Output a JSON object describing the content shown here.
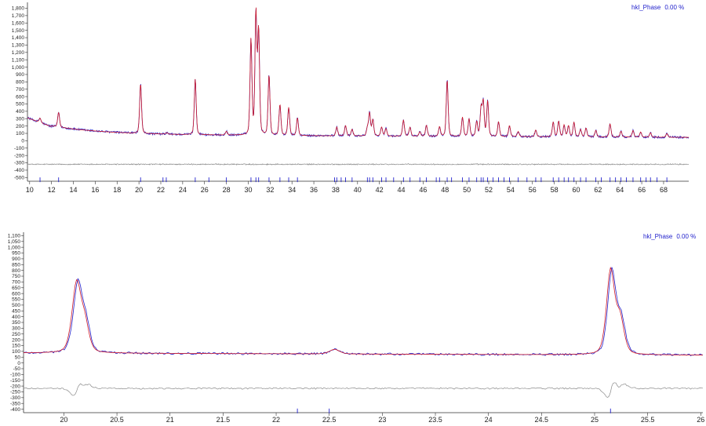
{
  "colors": {
    "observed": "#1f1fcc",
    "calculated": "#d01c2a",
    "difference": "#8a8a8a",
    "hkl": "#2222cc",
    "axis": "#333333"
  },
  "chart_data": [
    {
      "type": "line",
      "legend": {
        "label": "hkl_Phase",
        "value": "0.00 %",
        "placement": "top-right"
      },
      "xlim": [
        9.8,
        70.3
      ],
      "ylim": [
        -550,
        1880
      ],
      "y_ticks": [
        -500,
        -400,
        -300,
        -200,
        -100,
        0,
        100,
        200,
        300,
        400,
        500,
        600,
        700,
        800,
        900,
        1000,
        1100,
        1200,
        1300,
        1400,
        1500,
        1600,
        1700,
        1800
      ],
      "y_tick_labels": [
        "-500",
        "-400",
        "-300",
        "-200",
        "-100",
        "0",
        "100",
        "200",
        "300",
        "400",
        "500",
        "600",
        "700",
        "800",
        "900",
        "1,000",
        "1,100",
        "1,200",
        "1,300",
        "1,400",
        "1,500",
        "1,600",
        "1,700",
        "1,800"
      ],
      "x_ticks": [
        10,
        12,
        14,
        16,
        18,
        20,
        22,
        24,
        26,
        28,
        30,
        32,
        34,
        36,
        38,
        40,
        42,
        44,
        46,
        48,
        50,
        52,
        54,
        56,
        58,
        60,
        62,
        64,
        66,
        68
      ],
      "x_tick_labels": [
        "10",
        "12",
        "14",
        "16",
        "18",
        "20",
        "22",
        "24",
        "26",
        "28",
        "30",
        "32",
        "34",
        "36",
        "38",
        "40",
        "42",
        "44",
        "46",
        "48",
        "50",
        "52",
        "54",
        "56",
        "58",
        "60",
        "62",
        "64",
        "66",
        "68"
      ],
      "difference_offset": -320,
      "hkl_y": -530,
      "peaks": [
        {
          "pos": 10.95,
          "h": 60
        },
        {
          "pos": 12.65,
          "h": 200
        },
        {
          "pos": 20.15,
          "h": 680
        },
        {
          "pos": 25.15,
          "h": 760
        },
        {
          "pos": 22.55,
          "h": 20
        },
        {
          "pos": 28.0,
          "h": 50
        },
        {
          "pos": 30.25,
          "h": 1300
        },
        {
          "pos": 30.7,
          "h": 1650
        },
        {
          "pos": 30.95,
          "h": 1400
        },
        {
          "pos": 31.9,
          "h": 820
        },
        {
          "pos": 32.9,
          "h": 420
        },
        {
          "pos": 33.7,
          "h": 380
        },
        {
          "pos": 34.5,
          "h": 240
        },
        {
          "pos": 38.1,
          "h": 120
        },
        {
          "pos": 38.9,
          "h": 140
        },
        {
          "pos": 39.5,
          "h": 90
        },
        {
          "pos": 40.9,
          "h": 100
        },
        {
          "pos": 41.1,
          "h": 310
        },
        {
          "pos": 41.4,
          "h": 220
        },
        {
          "pos": 42.2,
          "h": 120
        },
        {
          "pos": 42.6,
          "h": 100
        },
        {
          "pos": 44.2,
          "h": 220
        },
        {
          "pos": 44.8,
          "h": 120
        },
        {
          "pos": 45.7,
          "h": 60
        },
        {
          "pos": 46.3,
          "h": 150
        },
        {
          "pos": 47.5,
          "h": 130
        },
        {
          "pos": 48.2,
          "h": 770
        },
        {
          "pos": 49.6,
          "h": 260
        },
        {
          "pos": 50.2,
          "h": 240
        },
        {
          "pos": 50.9,
          "h": 200
        },
        {
          "pos": 51.3,
          "h": 370
        },
        {
          "pos": 51.5,
          "h": 460
        },
        {
          "pos": 51.9,
          "h": 480
        },
        {
          "pos": 52.9,
          "h": 200
        },
        {
          "pos": 53.9,
          "h": 150
        },
        {
          "pos": 54.7,
          "h": 70
        },
        {
          "pos": 56.3,
          "h": 90
        },
        {
          "pos": 57.9,
          "h": 200
        },
        {
          "pos": 58.4,
          "h": 210
        },
        {
          "pos": 58.9,
          "h": 160
        },
        {
          "pos": 59.3,
          "h": 150
        },
        {
          "pos": 59.8,
          "h": 200
        },
        {
          "pos": 60.4,
          "h": 100
        },
        {
          "pos": 60.9,
          "h": 120
        },
        {
          "pos": 61.8,
          "h": 90
        },
        {
          "pos": 63.1,
          "h": 180
        },
        {
          "pos": 64.1,
          "h": 80
        },
        {
          "pos": 65.2,
          "h": 90
        },
        {
          "pos": 65.9,
          "h": 70
        },
        {
          "pos": 66.8,
          "h": 60
        },
        {
          "pos": 68.3,
          "h": 50
        }
      ],
      "hkl": [
        10.95,
        12.65,
        20.15,
        22.2,
        22.5,
        25.15,
        26.4,
        28.0,
        30.25,
        30.7,
        30.95,
        31.9,
        32.9,
        33.7,
        34.5,
        37.9,
        38.1,
        38.5,
        38.9,
        39.5,
        40.9,
        41.1,
        41.4,
        42.2,
        42.6,
        43.3,
        44.2,
        44.8,
        45.7,
        46.3,
        47.2,
        47.5,
        48.2,
        48.6,
        49.6,
        50.2,
        50.9,
        51.3,
        51.5,
        51.9,
        52.4,
        52.9,
        53.4,
        53.9,
        54.7,
        55.5,
        56.3,
        56.8,
        57.9,
        58.4,
        58.9,
        59.3,
        59.8,
        60.4,
        60.9,
        61.8,
        62.3,
        63.1,
        63.6,
        64.1,
        64.6,
        65.2,
        65.9,
        66.4,
        66.8,
        67.4,
        68.3
      ]
    },
    {
      "type": "line",
      "legend": {
        "label": "hkl_Phase",
        "value": "0.00 %",
        "placement": "top-right"
      },
      "xlim": [
        19.62,
        26.02
      ],
      "ylim": [
        -430,
        1130
      ],
      "y_ticks": [
        -400,
        -350,
        -300,
        -250,
        -200,
        -150,
        -100,
        -50,
        0,
        50,
        100,
        150,
        200,
        250,
        300,
        350,
        400,
        450,
        500,
        550,
        600,
        650,
        700,
        750,
        800,
        850,
        900,
        950,
        1000,
        1050,
        1100
      ],
      "y_tick_labels": [
        "-400",
        "-350",
        "-300",
        "-250",
        "-200",
        "-150",
        "-100",
        "-50",
        "0",
        "50",
        "100",
        "150",
        "200",
        "250",
        "300",
        "350",
        "400",
        "450",
        "500",
        "550",
        "600",
        "650",
        "700",
        "750",
        "800",
        "850",
        "900",
        "950",
        "1,000",
        "1,050",
        "1,100"
      ],
      "x_ticks": [
        20,
        20.5,
        21,
        21.5,
        22,
        22.5,
        23,
        23.5,
        24,
        24.5,
        25,
        25.5,
        26
      ],
      "x_tick_labels": [
        "20",
        "20.5",
        "21",
        "21.5",
        "22",
        "22.5",
        "23",
        "23.5",
        "24",
        "24.5",
        "25",
        "25.5",
        "26"
      ],
      "difference_offset": -220,
      "hkl_y": -415,
      "peaks": [
        {
          "pos": 20.12,
          "h": 600,
          "w": 0.045
        },
        {
          "pos": 20.2,
          "h": 220,
          "w": 0.04
        },
        {
          "pos": 22.55,
          "h": 40,
          "w": 0.05
        },
        {
          "pos": 25.15,
          "h": 720,
          "w": 0.04
        },
        {
          "pos": 25.24,
          "h": 300,
          "w": 0.04
        }
      ],
      "hkl": [
        22.2,
        22.5,
        25.15
      ]
    }
  ]
}
